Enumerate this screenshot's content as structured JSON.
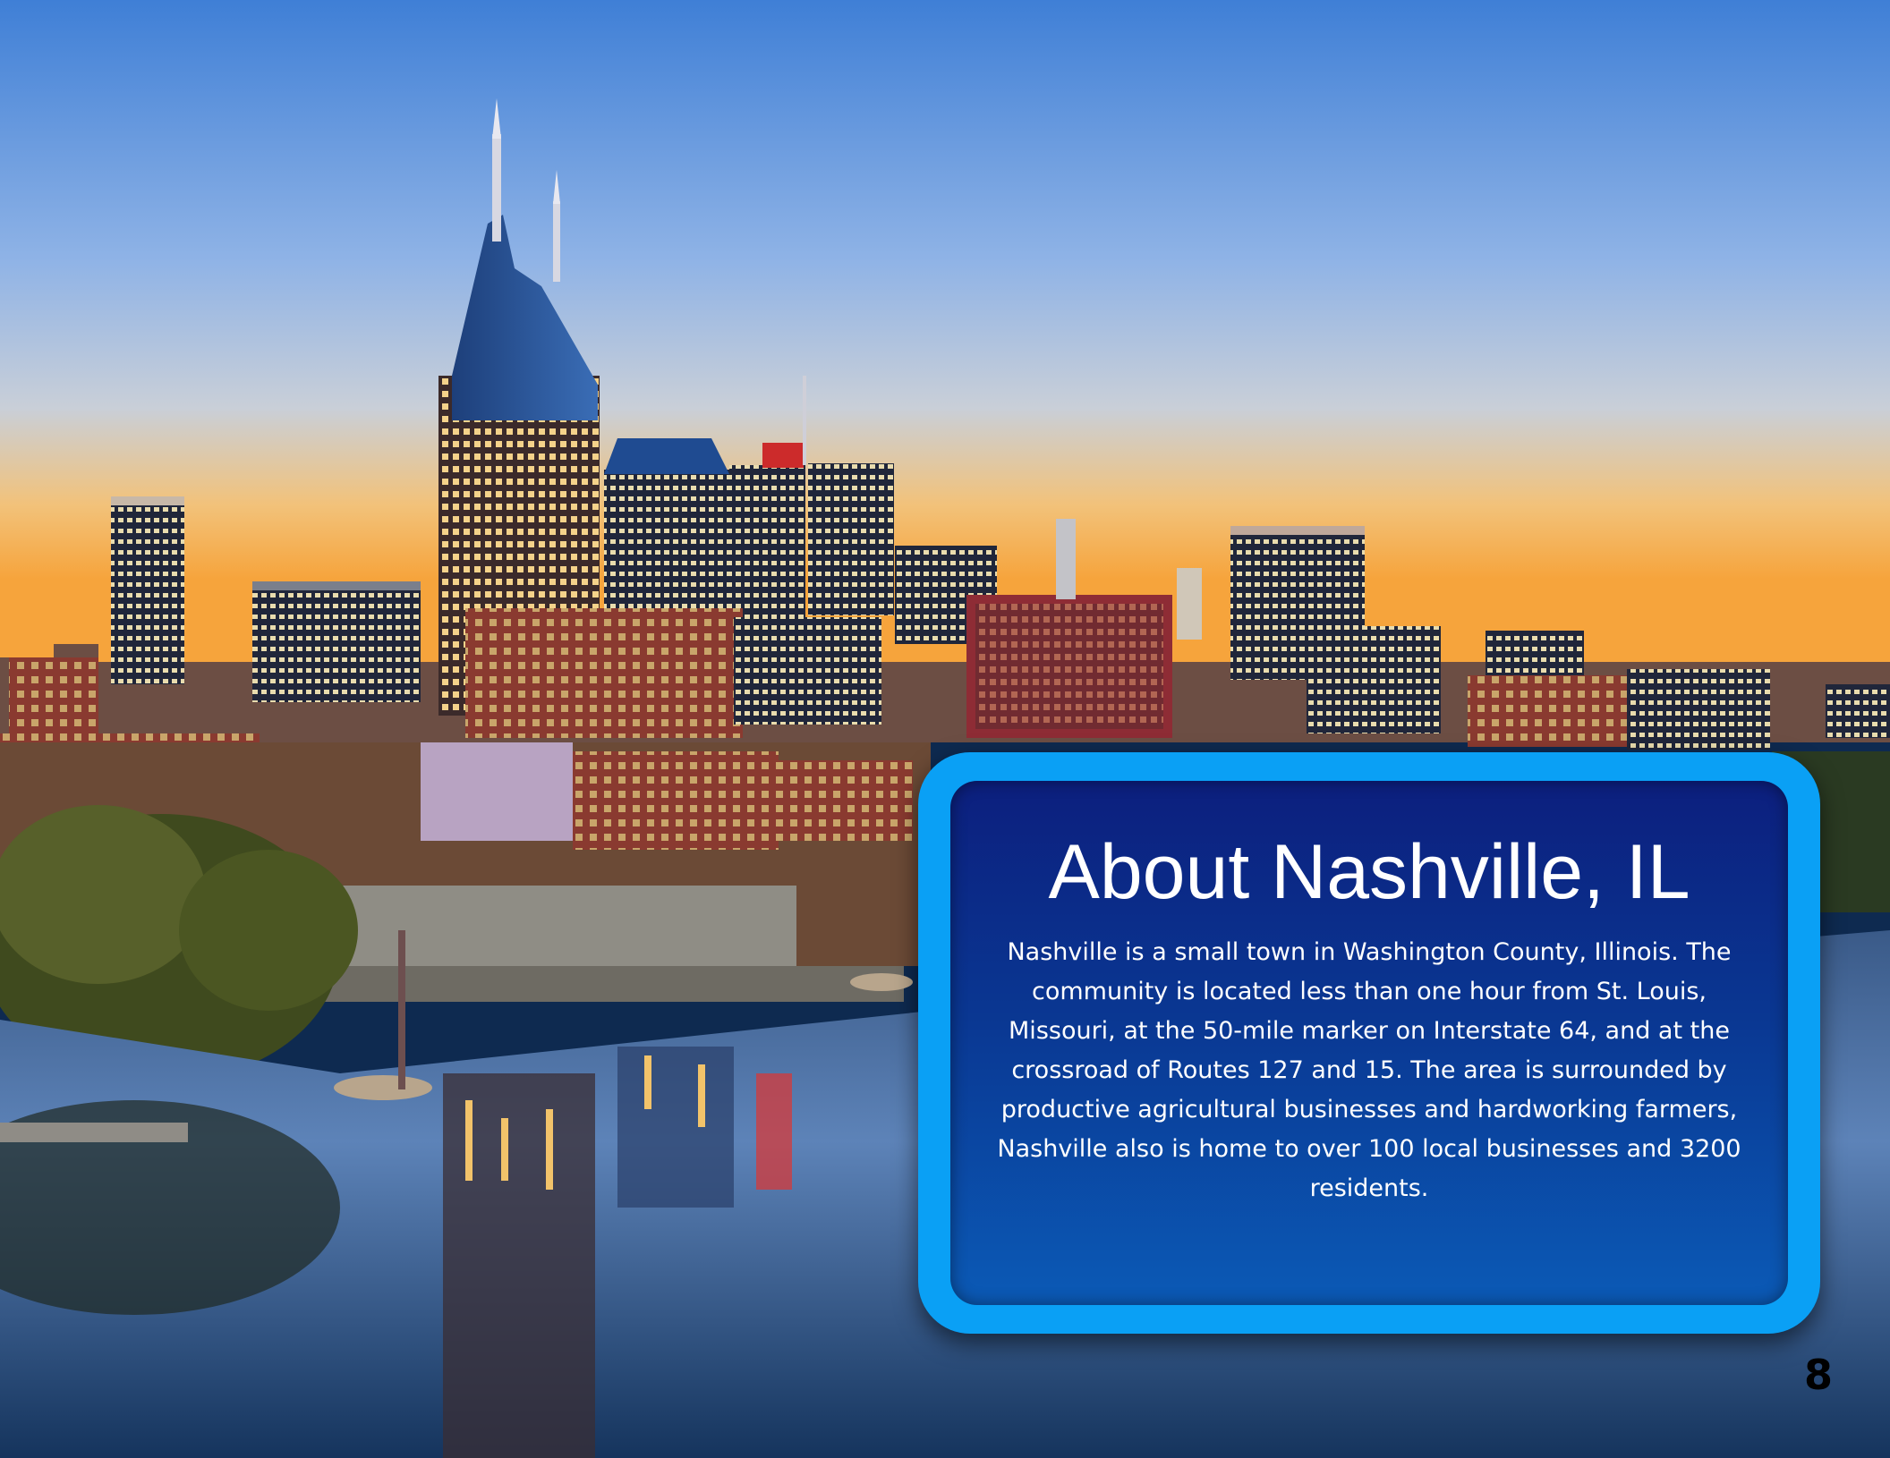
{
  "card": {
    "title": "About Nashville, IL",
    "body": "Nashville is a small town in Washington County, Illinois. The community is located less than one hour from St. Louis, Missouri, at the 50-mile marker on Interstate 64, and at the crossroad of Routes 127 and 15. The area is surrounded by productive agricultural businesses and hardworking farmers, Nashville also is home to over 100 local businesses and 3200 residents."
  },
  "page": {
    "number": "8"
  },
  "colors": {
    "card_frame": "#0aa0f5",
    "card_panel_top": "#0c1f7e",
    "card_panel_bottom": "#0b5ab6",
    "text": "#ffffff"
  }
}
